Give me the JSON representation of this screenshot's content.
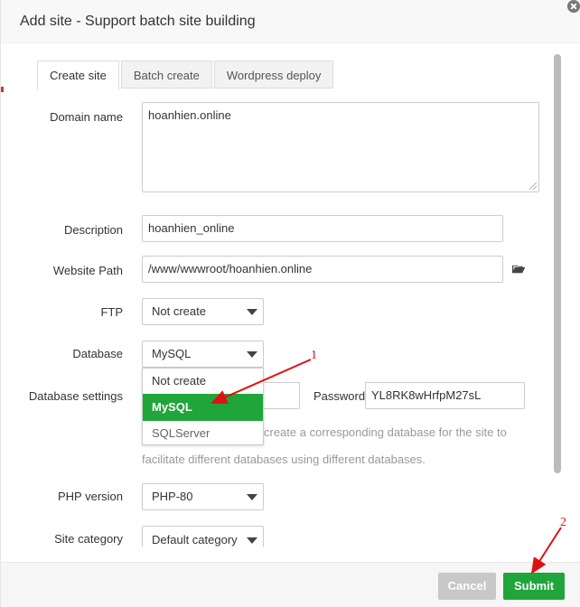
{
  "dialog": {
    "title": "Add site - Support batch site building"
  },
  "tabs": [
    {
      "label": "Create site",
      "active": true
    },
    {
      "label": "Batch create",
      "active": false
    },
    {
      "label": "Wordpress deploy",
      "active": false
    }
  ],
  "form": {
    "domain_label": "Domain name",
    "domain_value": "hoanhien.online",
    "description_label": "Description",
    "description_value": "hoanhien_online",
    "path_label": "Website Path",
    "path_value": "/www/wwwroot/hoanhien.online",
    "ftp_label": "FTP",
    "ftp_value": "Not create",
    "database_label": "Database",
    "database_value": "MySQL",
    "dbsettings_label": "Database settings",
    "password_label": "Password",
    "password_value": "YL8RK8wHrfpM27sL",
    "note_line1": "create a corresponding database for the site to",
    "note_line2": "facilitate different databases using different databases.",
    "php_label": "PHP version",
    "php_value": "PHP-80",
    "category_label": "Site category",
    "category_value": "Default category"
  },
  "database_dropdown": {
    "options": [
      "Not create",
      "MySQL",
      "SQLServer"
    ],
    "selected": "MySQL"
  },
  "buttons": {
    "cancel": "Cancel",
    "submit": "Submit"
  },
  "annotations": {
    "marker1": "1",
    "marker2": "2"
  },
  "colors": {
    "accent": "#20a53a",
    "annotation": "#e01010",
    "cancel_bg": "#c8c8c8"
  },
  "icons": {
    "folder": "folder-open-icon",
    "close": "close-icon"
  }
}
